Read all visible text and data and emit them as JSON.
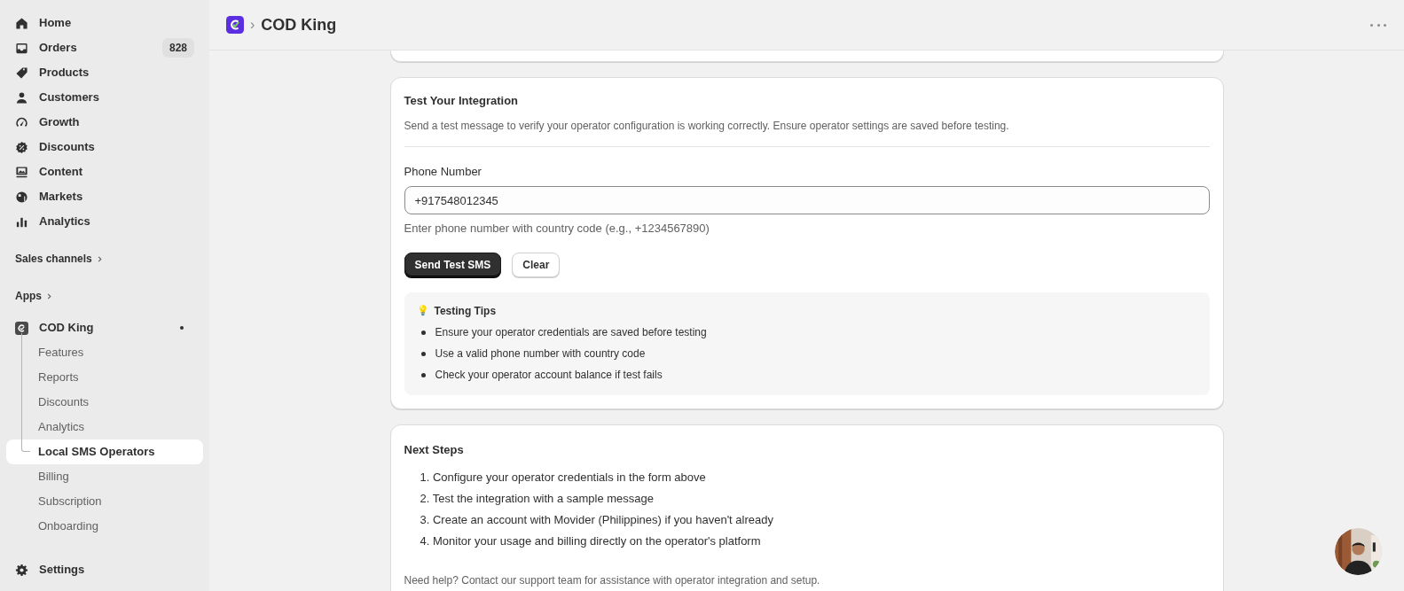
{
  "sidebar": {
    "nav": [
      {
        "label": "Home",
        "selected": false
      },
      {
        "label": "Orders",
        "badge": "828",
        "selected": false
      },
      {
        "label": "Products",
        "selected": false
      },
      {
        "label": "Customers",
        "selected": false
      },
      {
        "label": "Growth",
        "selected": false
      },
      {
        "label": "Discounts",
        "selected": false
      },
      {
        "label": "Content",
        "selected": false
      },
      {
        "label": "Markets",
        "selected": false
      },
      {
        "label": "Analytics",
        "selected": false
      }
    ],
    "sections": [
      "Sales channels",
      "Apps"
    ],
    "app": {
      "label": "COD King",
      "pinned": true,
      "items": [
        {
          "label": "Features",
          "selected": false
        },
        {
          "label": "Reports",
          "selected": false
        },
        {
          "label": "Discounts",
          "selected": false
        },
        {
          "label": "Analytics",
          "selected": false
        },
        {
          "label": "Local SMS Operators",
          "selected": true
        },
        {
          "label": "Billing",
          "selected": false
        },
        {
          "label": "Subscription",
          "selected": false
        },
        {
          "label": "Onboarding",
          "selected": false
        }
      ]
    },
    "settings": "Settings"
  },
  "header": {
    "breadcrumb_separator": "›",
    "title": "COD King"
  },
  "test_card": {
    "title": "Test Your Integration",
    "description": "Send a test message to verify your operator configuration is working correctly. Ensure operator settings are saved before testing.",
    "field": {
      "label": "Phone Number",
      "value": "+917548012345",
      "help": "Enter phone number with country code (e.g., +1234567890)"
    },
    "buttons": [
      {
        "label": "Send Test SMS",
        "kind": "primary"
      },
      {
        "label": "Clear",
        "kind": "secondary"
      }
    ],
    "tips": {
      "icon": "💡",
      "title": "Testing Tips",
      "items": [
        "Ensure your operator credentials are saved before testing",
        "Use a valid phone number with country code",
        "Check your operator account balance if test fails"
      ]
    }
  },
  "next_card": {
    "title": "Next Steps",
    "steps": [
      "1. Configure your operator credentials in the form above",
      "2. Test the integration with a sample message",
      "3. Create an account with Movider (Philippines) if you haven't already",
      "4. Monitor your usage and billing directly on the operator's platform"
    ],
    "footer": "Need help? Contact our support team for assistance with operator integration and setup."
  }
}
